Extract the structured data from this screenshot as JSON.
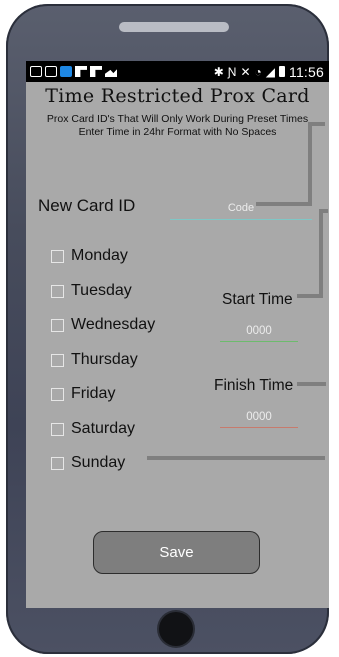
{
  "status_bar": {
    "time": "11:56",
    "icons_left": [
      "message-icon",
      "image-icon",
      "app-icon",
      "flipboard-icon",
      "flipboard-icon",
      "gallery-icon"
    ],
    "icons_right": [
      "bluetooth-icon",
      "nfc-icon",
      "mute-icon",
      "wifi-icon",
      "signal-icon",
      "battery-icon"
    ]
  },
  "header": {
    "title": "Time Restricted Prox Card",
    "subtitle_line1": "Prox Card ID's That Will Only Work During Preset Times",
    "subtitle_line2": "Enter Time in 24hr Format with No Spaces"
  },
  "card": {
    "label": "New Card ID",
    "placeholder": "Code"
  },
  "days": [
    "Monday",
    "Tuesday",
    "Wednesday",
    "Thursday",
    "Friday",
    "Saturday",
    "Sunday"
  ],
  "start": {
    "label": "Start Time",
    "placeholder": "0000"
  },
  "finish": {
    "label": "Finish Time",
    "placeholder": "0000"
  },
  "save_label": "Save",
  "colors": {
    "screen_background": "#a9a9a9",
    "code_underline": "#7fc7c6",
    "start_underline": "#6dbb6d",
    "finish_underline": "#c77b6d"
  }
}
